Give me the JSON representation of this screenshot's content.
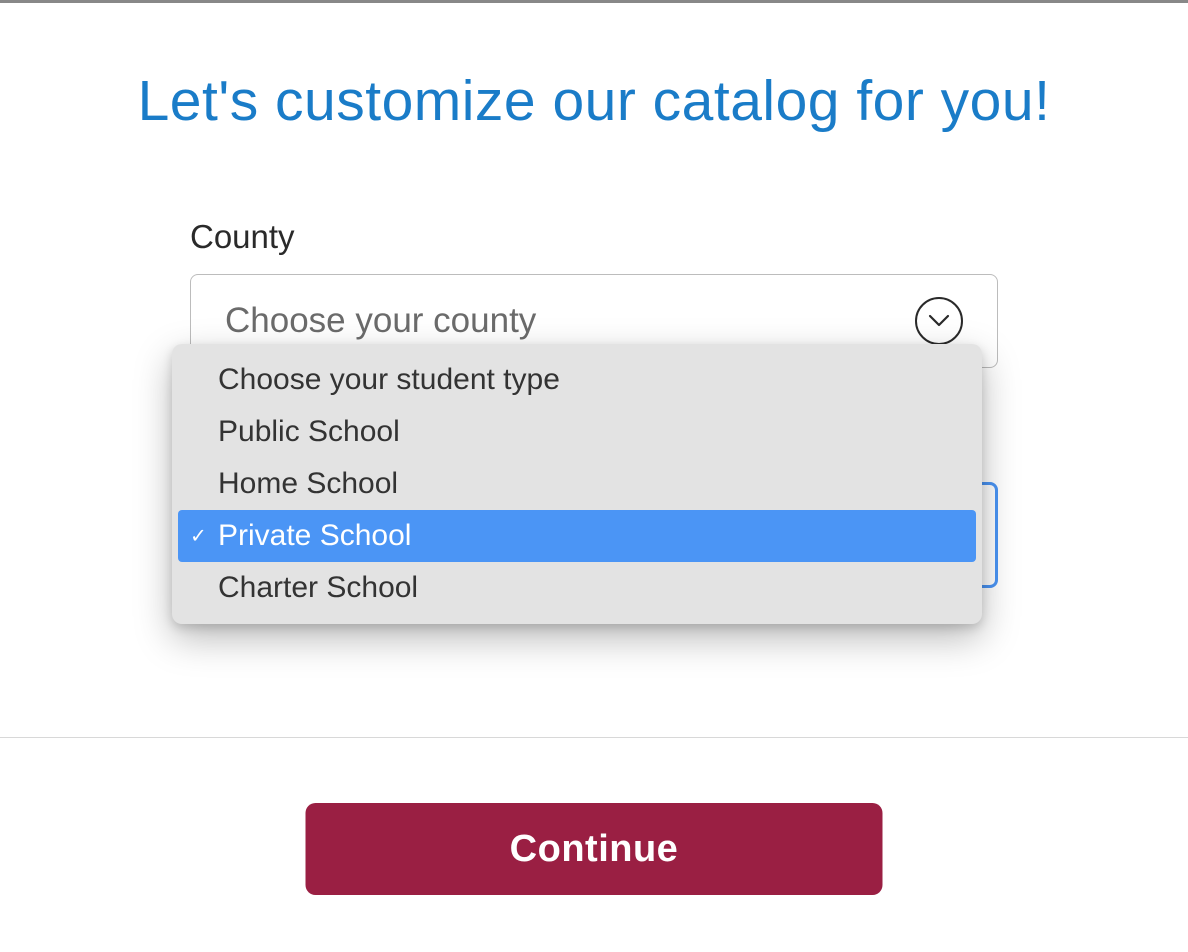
{
  "title": "Let's customize our catalog for you!",
  "county": {
    "label": "County",
    "placeholder": "Choose your county"
  },
  "student_type": {
    "placeholder_option": "Choose your student type",
    "options": [
      "Public School",
      "Home School",
      "Private School",
      "Charter School"
    ],
    "selected": "Private School"
  },
  "continue_label": "Continue",
  "colors": {
    "title": "#1a7cc8",
    "select_highlight": "#4b95f5",
    "button": "#9a1f43"
  }
}
